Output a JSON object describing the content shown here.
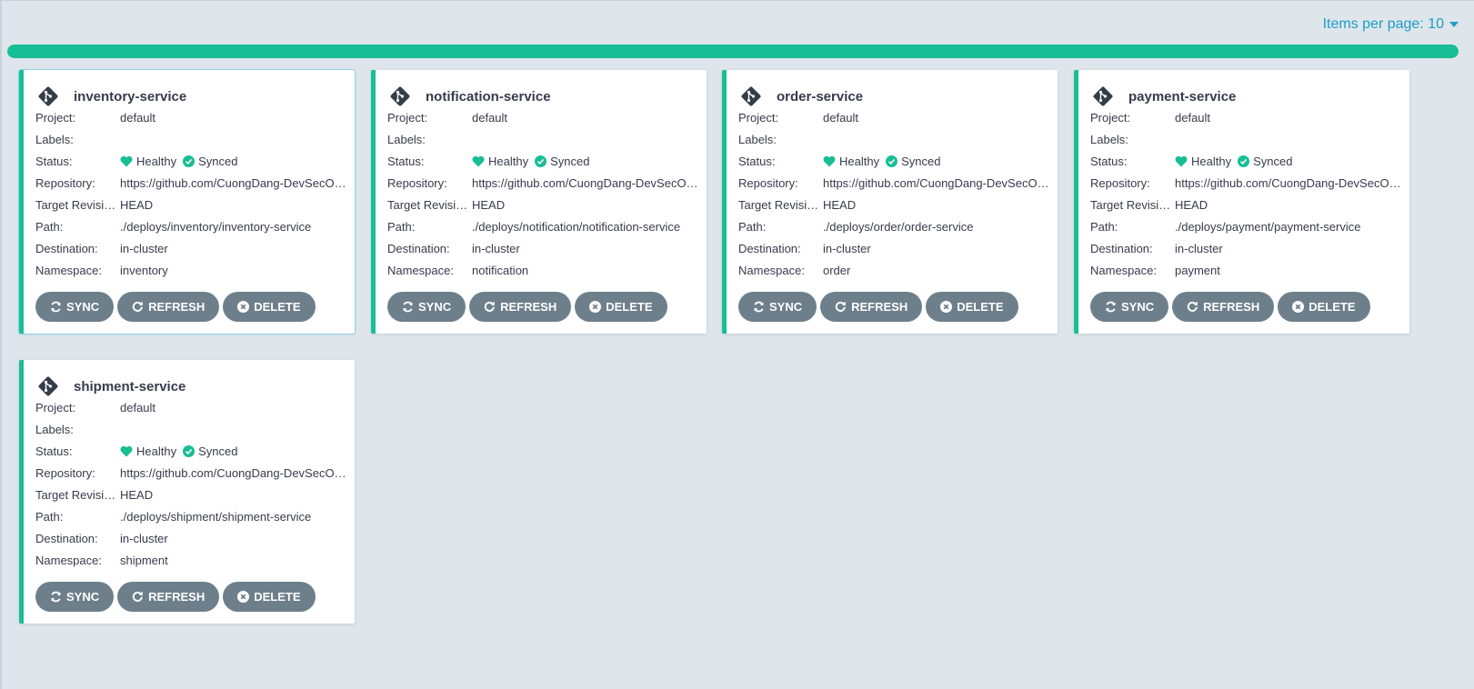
{
  "pagination": {
    "items_per_page": "Items per page: 10"
  },
  "progress": {
    "fraction": 1.0
  },
  "labels": {
    "project": "Project:",
    "labels": "Labels:",
    "status": "Status:",
    "repository": "Repository:",
    "target_revision": "Target Revision:",
    "path": "Path:",
    "destination": "Destination:",
    "namespace": "Namespace:"
  },
  "buttons": {
    "sync": "SYNC",
    "refresh": "REFRESH",
    "delete": "DELETE"
  },
  "colors": {
    "accent": "#18be94",
    "button": "#6d7f8b",
    "link": "#1f9cc6"
  },
  "apps": [
    {
      "name": "inventory-service",
      "project": "default",
      "labels": "",
      "health": "Healthy",
      "sync": "Synced",
      "repository": "https://github.com/CuongDang-DevSecOps/",
      "target_revision": "HEAD",
      "path": "./deploys/inventory/inventory-service",
      "destination": "in-cluster",
      "namespace": "inventory"
    },
    {
      "name": "notification-service",
      "project": "default",
      "labels": "",
      "health": "Healthy",
      "sync": "Synced",
      "repository": "https://github.com/CuongDang-DevSecOps/",
      "target_revision": "HEAD",
      "path": "./deploys/notification/notification-service",
      "destination": "in-cluster",
      "namespace": "notification"
    },
    {
      "name": "order-service",
      "project": "default",
      "labels": "",
      "health": "Healthy",
      "sync": "Synced",
      "repository": "https://github.com/CuongDang-DevSecOps/",
      "target_revision": "HEAD",
      "path": "./deploys/order/order-service",
      "destination": "in-cluster",
      "namespace": "order"
    },
    {
      "name": "payment-service",
      "project": "default",
      "labels": "",
      "health": "Healthy",
      "sync": "Synced",
      "repository": "https://github.com/CuongDang-DevSecOps/",
      "target_revision": "HEAD",
      "path": "./deploys/payment/payment-service",
      "destination": "in-cluster",
      "namespace": "payment"
    },
    {
      "name": "shipment-service",
      "project": "default",
      "labels": "",
      "health": "Healthy",
      "sync": "Synced",
      "repository": "https://github.com/CuongDang-DevSecOps/",
      "target_revision": "HEAD",
      "path": "./deploys/shipment/shipment-service",
      "destination": "in-cluster",
      "namespace": "shipment"
    }
  ]
}
